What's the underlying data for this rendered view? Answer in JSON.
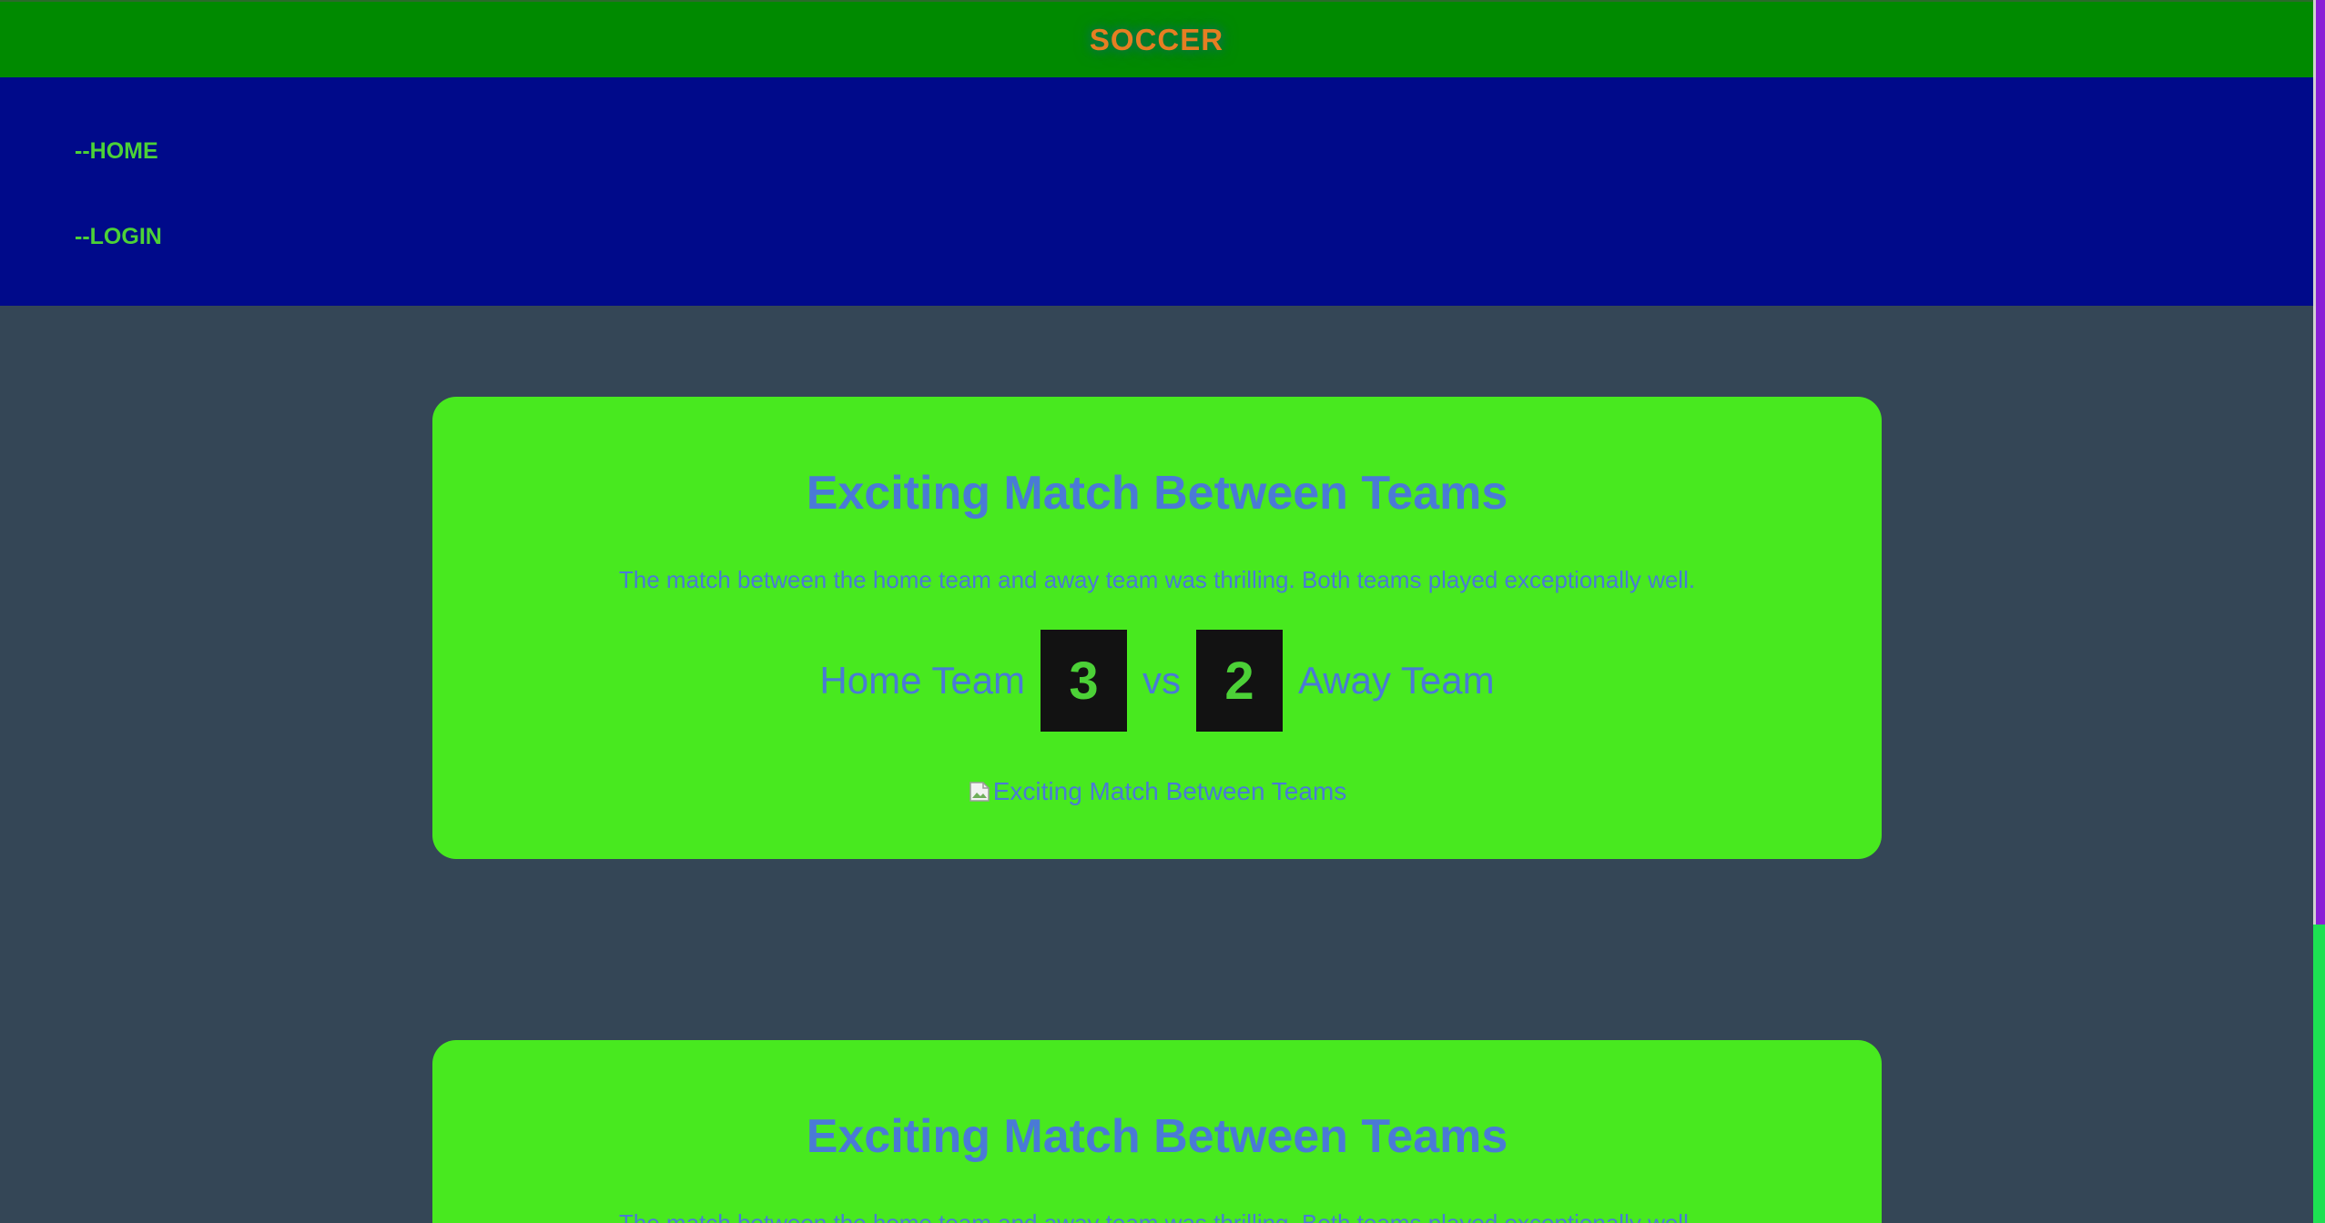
{
  "header": {
    "brand": "SOCCER"
  },
  "nav": {
    "items": [
      {
        "label": "--HOME"
      },
      {
        "label": "--LOGIN"
      }
    ]
  },
  "matches": [
    {
      "title": "Exciting Match Between Teams",
      "description": "The match between the home team and away team was thrilling. Both teams played exceptionally well.",
      "home_team": "Home Team",
      "home_score": "3",
      "vs": "vs",
      "away_score": "2",
      "away_team": "Away Team",
      "image_alt": "Exciting Match Between Teams"
    },
    {
      "title": "Exciting Match Between Teams",
      "description": "The match between the home team and away team was thrilling. Both teams played exceptionally well."
    }
  ],
  "colors": {
    "header_bg": "#008a00",
    "brand": "#e67e22",
    "nav_bg": "#000a8a",
    "nav_link": "#4cd137",
    "page_bg": "#344656",
    "card_bg": "#48e91f",
    "card_text": "#4a7ad6",
    "score_bg": "#121212",
    "score_text": "#4cd137"
  },
  "icons": {
    "broken_image": "broken-image-icon"
  }
}
